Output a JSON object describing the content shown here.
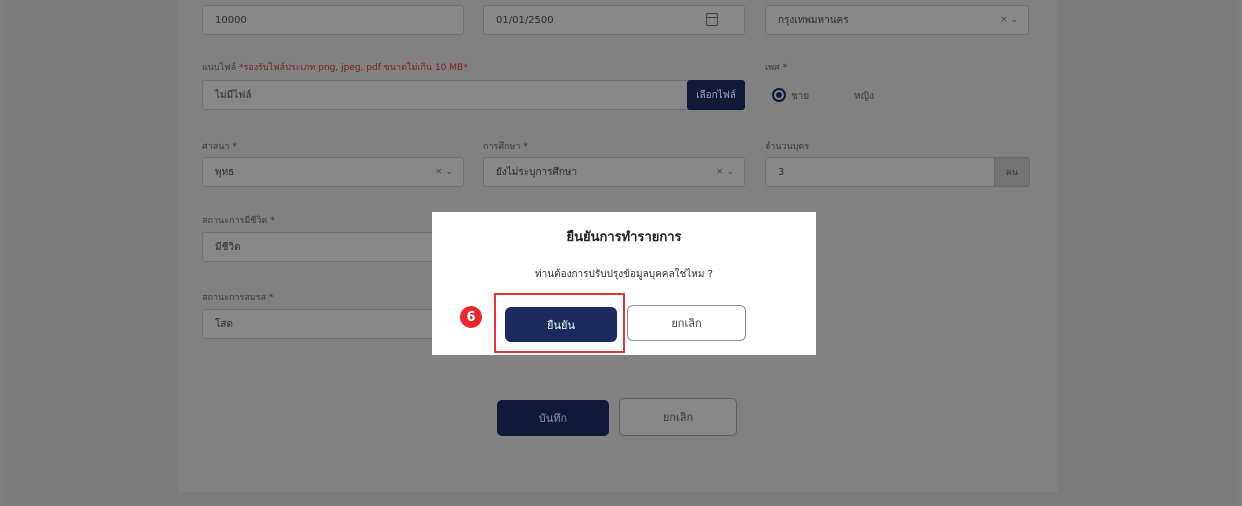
{
  "form": {
    "row1": {
      "field1_value": "10000",
      "date_value": "01/01/2500",
      "province_value": "กรุงเทพมหานคร"
    },
    "document": {
      "label": "แนบไฟล์",
      "note": "*รองรับไฟล์ประเภท png, jpeg, pdf ขนาดไม่เกิน 10 MB*",
      "value": "ไม่มีไฟล์",
      "browse_label": "เลือกไฟล์"
    },
    "gender": {
      "label": "เพศ *",
      "options": [
        "ชาย",
        "หญิง"
      ],
      "selected": "ชาย"
    },
    "religion": {
      "label": "ศาสนา *",
      "value": "พุทธ"
    },
    "education": {
      "label": "การศึกษา *",
      "value": "ยังไม่ระบุการศึกษา"
    },
    "family": {
      "label": "จำนวนบุตร",
      "value": "3",
      "unit": "คน"
    },
    "life_status": {
      "label": "สถานะการมีชีวิต *",
      "value": "มีชีวิต"
    },
    "marital_status": {
      "label": "สถานะการสมรส *",
      "value": "โสด"
    },
    "save_label": "บันทึก",
    "cancel_label": "ยกเลิก"
  },
  "modal": {
    "title": "ยืนยันการทำรายการ",
    "message": "ท่านต้องการปรับปรุงข้อมูลบุคคลใช่ไหม ?",
    "confirm_label": "ยืนยัน",
    "cancel_label": "ยกเลิก"
  },
  "annotation": {
    "step": "6",
    "color": "#e8292f"
  }
}
